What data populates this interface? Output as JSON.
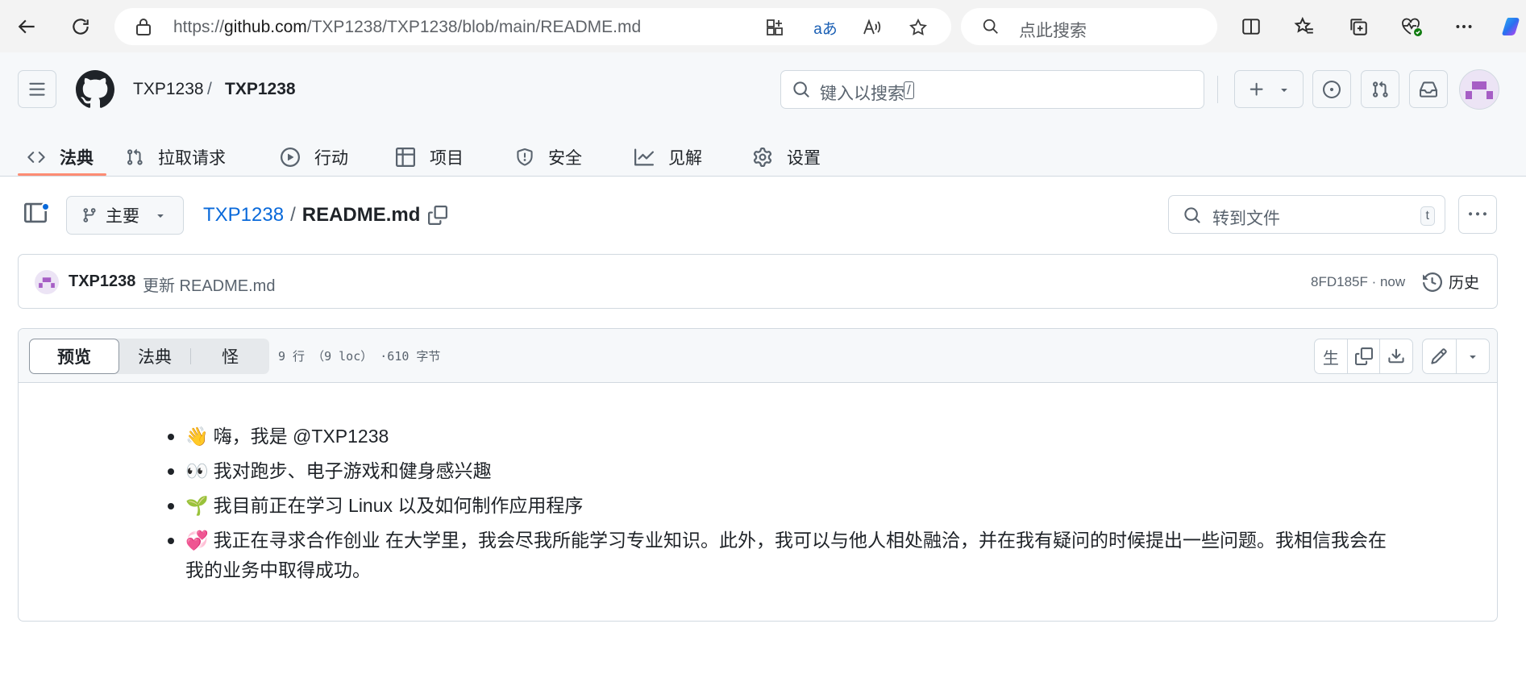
{
  "browser": {
    "url_prefix": "https://",
    "url_domain": "github.com",
    "url_path": "/TXP1238/TXP1238/blob/main/README.md",
    "translate_icon_text": "aあ",
    "search_placeholder": "点此搜索"
  },
  "header": {
    "owner": "TXP1238",
    "separator": "/",
    "repo": "TXP1238",
    "search_placeholder": "键入以搜索",
    "search_shortcut": "/"
  },
  "repo_tabs": [
    {
      "label": "法典",
      "icon": "code-icon"
    },
    {
      "label": "拉取请求",
      "icon": "pull-request-icon"
    },
    {
      "label": "行动",
      "icon": "play-icon"
    },
    {
      "label": "项目",
      "icon": "table-icon"
    },
    {
      "label": "安全",
      "icon": "shield-icon"
    },
    {
      "label": "见解",
      "icon": "graph-icon"
    },
    {
      "label": "设置",
      "icon": "gear-icon"
    }
  ],
  "file_nav": {
    "branch": "主要",
    "repo_link": "TXP1238",
    "path_separator": "/",
    "file_name": "README.md",
    "goto_placeholder": "转到文件",
    "goto_shortcut": "t"
  },
  "commit": {
    "author": "TXP1238",
    "message": "更新 README.md",
    "sha_time": "8FD185F · now",
    "history_label": "历史"
  },
  "file_view": {
    "tabs": [
      "预览",
      "法典",
      "怪"
    ],
    "stats": "9 行 （9 loc） ·610 字节",
    "raw_label": "生"
  },
  "readme": {
    "items": [
      {
        "emoji": "👋",
        "text": "嗨，我是 @TXP1238"
      },
      {
        "emoji": "👀",
        "text": "我对跑步、电子游戏和健身感兴趣"
      },
      {
        "emoji": "🌱",
        "text": "我目前正在学习 Linux 以及如何制作应用程序"
      },
      {
        "emoji": "💞️",
        "text": "我正在寻求合作创业 在大学里，我会尽我所能学习专业知识。此外，我可以与他人相处融洽，并在我有疑问的时候提出一些问题。我相信我会在我的业务中取得成功。"
      }
    ]
  },
  "colors": {
    "accent_link": "#0969da",
    "tab_underline": "#fd8c73",
    "avatar_purple": "#a65ec5"
  }
}
